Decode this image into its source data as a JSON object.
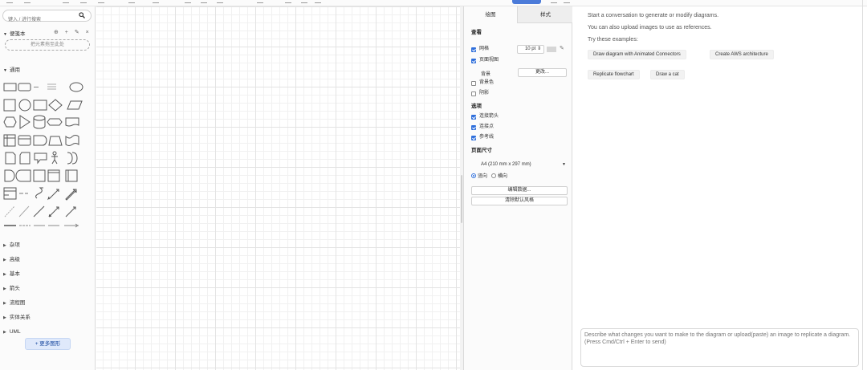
{
  "sidebar": {
    "search_placeholder": "键入 / 进行搜索",
    "scratchpad_title": "便笺本",
    "scratchpad_tools": "⊕ + ✎ ×",
    "dropzone_text": "把元素拖至此处",
    "general_title": "通用",
    "categories": [
      "杂项",
      "高级",
      "基本",
      "箭头",
      "流程图",
      "实体关系",
      "UML"
    ],
    "more_shapes": "+ 更多图形"
  },
  "format": {
    "tab_diagram": "绘图",
    "tab_style": "样式",
    "view_label": "查看",
    "grid_label": "网格",
    "grid_size": "10 pt",
    "page_view_label": "页面视图",
    "background_label": "背景",
    "change_button": "更改...",
    "bg_color_label": "背景色",
    "shadow_label": "阴影",
    "options_label": "选项",
    "connection_arrows_label": "连接箭头",
    "connection_points_label": "连接点",
    "guides_label": "参考线",
    "paper_size_label": "页面尺寸",
    "paper_size_value": "A4 (210 mm x 297 mm)",
    "portrait_label": "竖向",
    "landscape_label": "横向",
    "edit_data_button": "编辑数据...",
    "clear_style_button": "清除默认风格"
  },
  "chat": {
    "intro_1": "Start a conversation to generate or modify diagrams.",
    "intro_2": "You can also upload images to use as references.",
    "intro_3": "Try these examples:",
    "suggestions": [
      "Draw diagram with Animated Connectors",
      "Create AWS architecture",
      "Replicate flowchart",
      "Draw a cat"
    ],
    "prompt_placeholder": "Describe what changes you want to make to the diagram or upload(paste) an image to replicate a diagram. (Press Cmd/Ctrl + Enter to send)"
  },
  "icons": {
    "search": "search-icon",
    "caret": "caret-icon",
    "pencil": "pencil-icon"
  }
}
